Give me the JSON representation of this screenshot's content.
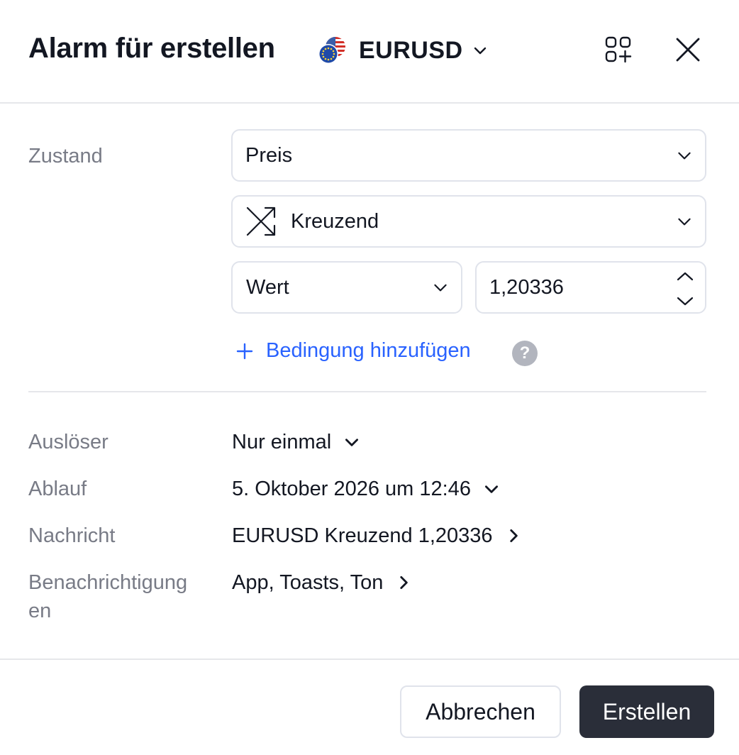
{
  "header": {
    "title": "Alarm für erstellen",
    "symbol": "EURUSD",
    "flag_icon": "eur-usd-flag-icon",
    "add_icon": "add-widget-icon",
    "close_icon": "close-icon"
  },
  "condition": {
    "label": "Zustand",
    "source_value": "Preis",
    "operator_value": "Kreuzend",
    "operator_icon": "crossing-arrows-icon",
    "type_value": "Wert",
    "value_input": "1,20336",
    "add_condition_label": "Bedingung hinzufügen",
    "help_glyph": "?"
  },
  "settings": {
    "trigger_label": "Auslöser",
    "trigger_value": "Nur einmal",
    "expiry_label": "Ablauf",
    "expiry_value": "5. Oktober 2026 um 12:46",
    "message_label": "Nachricht",
    "message_value": "EURUSD Kreuzend 1,20336",
    "notifications_label_1": "Benachrichtigung",
    "notifications_label_2": "en",
    "notifications_value": "App, Toasts, Ton"
  },
  "footer": {
    "cancel_label": "Abbrechen",
    "create_label": "Erstellen"
  },
  "colors": {
    "accent": "#2962ff",
    "primary_button": "#2a2e39",
    "muted_text": "#787b86",
    "border": "#e0e3eb"
  }
}
